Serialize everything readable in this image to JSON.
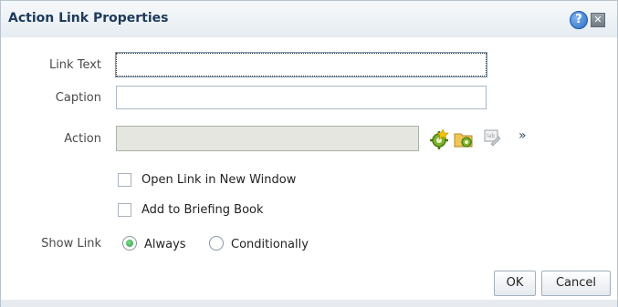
{
  "dialog": {
    "title": "Action Link Properties",
    "help_symbol": "?",
    "close_symbol": "✕"
  },
  "form": {
    "link_text_label": "Link Text",
    "link_text_value": "",
    "caption_label": "Caption",
    "caption_value": "",
    "action_label": "Action",
    "action_value": "",
    "more_symbol": "»",
    "open_new_window_label": "Open Link in New Window",
    "open_new_window_checked": false,
    "briefing_book_label": "Add to Briefing Book",
    "briefing_book_checked": false,
    "show_link_label": "Show Link",
    "show_link_options": [
      "Always",
      "Conditionally"
    ],
    "show_link_selected": "Always"
  },
  "icons": [
    "create-navigate-action-icon",
    "select-existing-action-icon",
    "edit-parameter-mapping-icon",
    "more-options-icon"
  ],
  "footer": {
    "ok_label": "OK",
    "cancel_label": "Cancel"
  }
}
